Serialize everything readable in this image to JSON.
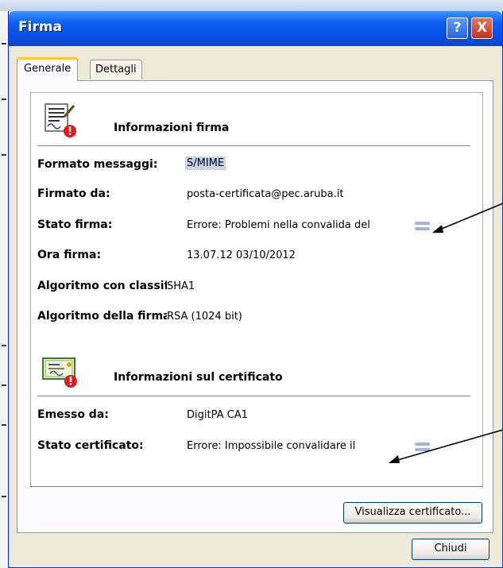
{
  "window": {
    "title": "Firma",
    "help_glyph": "?",
    "close_glyph": "X"
  },
  "tabs": [
    {
      "label": "Generale",
      "active": true
    },
    {
      "label": "Dettagli",
      "active": false
    }
  ],
  "signature_section": {
    "heading": "Informazioni firma",
    "icon": "signed-document-error-icon",
    "rows": [
      {
        "label": "Formato messaggi:",
        "value": "S/MIME",
        "selected": true
      },
      {
        "label": "Firmato da:",
        "value": "posta-certificata@pec.aruba.it"
      },
      {
        "label": "Stato firma:",
        "value": "Errore: Problemi nella convalida del",
        "has_detail": true
      },
      {
        "label": "Ora firma:",
        "value": "13.07.12 03/10/2012"
      },
      {
        "label": "Algoritmo con classifi",
        "value": "SHA1"
      },
      {
        "label": "Algoritmo della firma",
        "value": "RSA (1024 bit)"
      }
    ]
  },
  "certificate_section": {
    "heading": "Informazioni sul certificato",
    "icon": "certificate-error-icon",
    "rows": [
      {
        "label": "Emesso da:",
        "value": "DigitPA CA1"
      },
      {
        "label": "Stato certificato:",
        "value": "Errore: Impossibile convalidare il",
        "has_detail": true
      }
    ]
  },
  "buttons": {
    "view_certificate": "Visualizza certificato...",
    "close": "Chiudi"
  },
  "colors": {
    "titlebar": "#0a5ef0",
    "dialog_face": "#ece9d8",
    "active_tab_accent": "#ffc83c",
    "error_badge": "#e01b1b",
    "detail_button": "#9fb5dd"
  }
}
